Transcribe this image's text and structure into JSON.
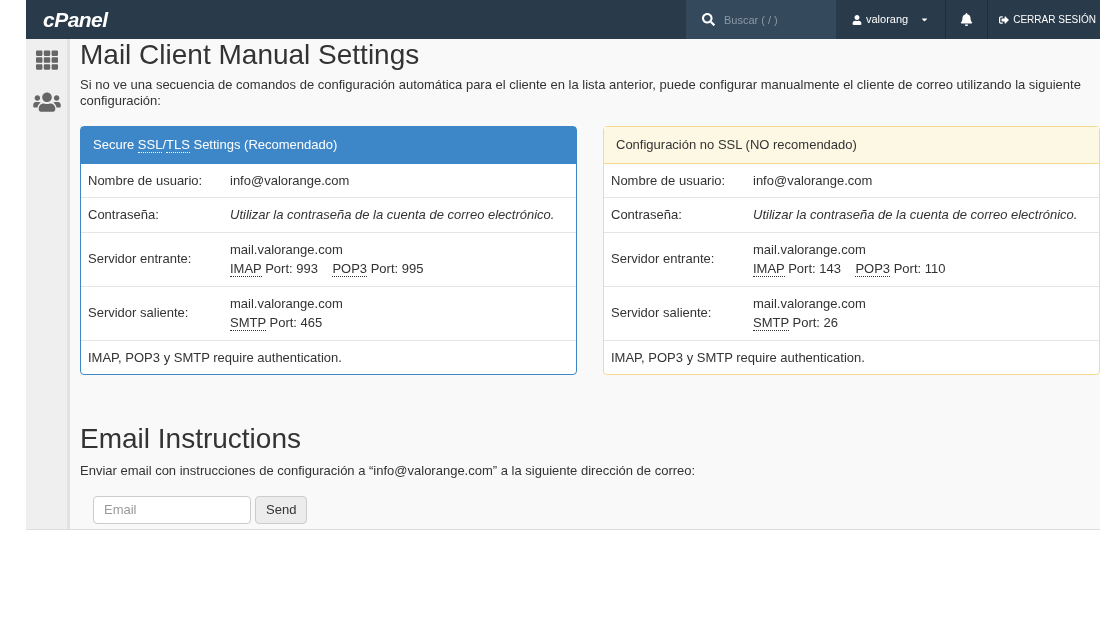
{
  "topbar": {
    "logo": "cPanel",
    "search": {
      "placeholder": "Buscar ( / )"
    },
    "user": "valorang",
    "logout": "CERRAR SESIÓN"
  },
  "title": "Mail Client Manual Settings",
  "intro": "Si no ve una secuencia de comandos de configuración automática para el cliente en la lista anterior, puede configurar manualmente el cliente de correo utilizando la siguiente configuración:",
  "panels": [
    {
      "kind": "primary",
      "heading": [
        {
          "text": "Secure "
        },
        {
          "abbr": "SSL"
        },
        {
          "text": "/"
        },
        {
          "abbr": "TLS"
        },
        {
          "text": " Settings (Recomendado)"
        }
      ],
      "rows": [
        {
          "label": "Nombre de usuario:",
          "kind": "plain",
          "lines": [
            [
              {
                "text": "info@valorange.com"
              }
            ]
          ]
        },
        {
          "label": "Contraseña:",
          "kind": "italic",
          "lines": [
            [
              {
                "text": "Utilizar la contraseña de la cuenta de correo electrónico."
              }
            ]
          ]
        },
        {
          "label": "Servidor entrante:",
          "kind": "plain",
          "lines": [
            [
              {
                "text": "mail.valorange.com"
              }
            ],
            [
              {
                "abbr": "IMAP"
              },
              {
                "text": " Port: 993    "
              },
              {
                "abbr": "POP3"
              },
              {
                "text": " Port: 995"
              }
            ]
          ]
        },
        {
          "label": "Servidor saliente:",
          "kind": "plain",
          "lines": [
            [
              {
                "text": "mail.valorange.com"
              }
            ],
            [
              {
                "abbr": "SMTP"
              },
              {
                "text": " Port: 465"
              }
            ]
          ]
        }
      ],
      "footer": "IMAP, POP3 y SMTP require authentication."
    },
    {
      "kind": "warning",
      "heading": [
        {
          "text": "Configuración no SSL (NO recomendado)"
        }
      ],
      "rows": [
        {
          "label": "Nombre de usuario:",
          "kind": "plain",
          "lines": [
            [
              {
                "text": "info@valorange.com"
              }
            ]
          ]
        },
        {
          "label": "Contraseña:",
          "kind": "italic",
          "lines": [
            [
              {
                "text": "Utilizar la contraseña de la cuenta de correo electrónico."
              }
            ]
          ]
        },
        {
          "label": "Servidor entrante:",
          "kind": "plain",
          "lines": [
            [
              {
                "text": "mail.valorange.com"
              }
            ],
            [
              {
                "abbr": "IMAP"
              },
              {
                "text": " Port: 143    "
              },
              {
                "abbr": "POP3"
              },
              {
                "text": " Port: 110"
              }
            ]
          ]
        },
        {
          "label": "Servidor saliente:",
          "kind": "plain",
          "lines": [
            [
              {
                "text": "mail.valorange.com"
              }
            ],
            [
              {
                "abbr": "SMTP"
              },
              {
                "text": " Port: 26"
              }
            ]
          ]
        }
      ],
      "footer": "IMAP, POP3 y SMTP require authentication."
    }
  ],
  "instructions": {
    "title": "Email Instructions",
    "text": "Enviar email con instrucciones de configuración a “info@valorange.com” a la siguiente dirección de correo:",
    "email": {
      "placeholder": "Email"
    },
    "button": "Send"
  }
}
